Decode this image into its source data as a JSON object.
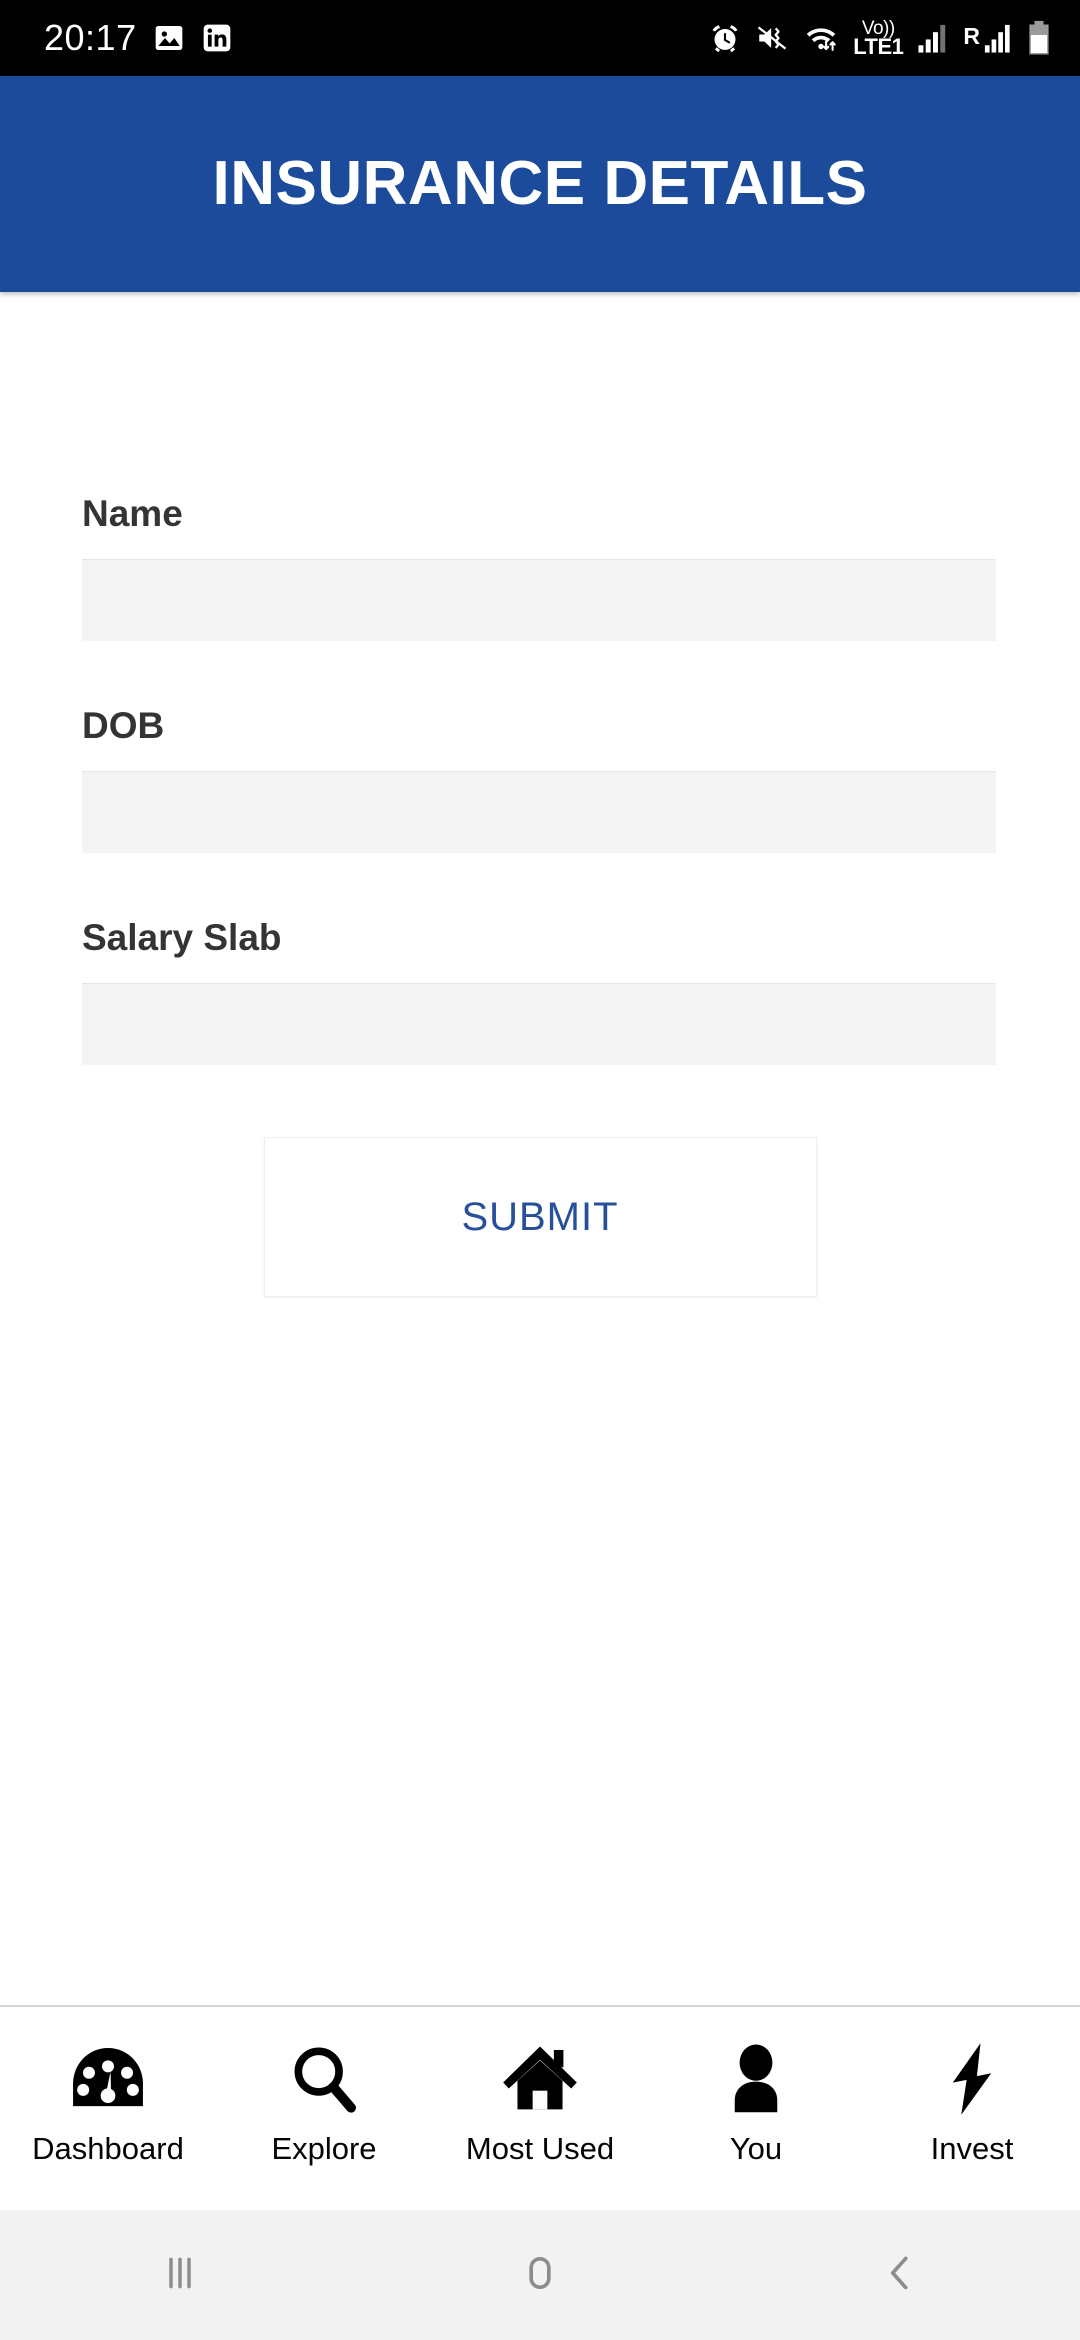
{
  "status_bar": {
    "time": "20:17",
    "left_icons": [
      {
        "name": "photo-icon",
        "label": "image"
      },
      {
        "name": "linkedin-icon",
        "label": "in"
      }
    ],
    "right_icons": [
      {
        "name": "alarm-icon",
        "label": "alarm"
      },
      {
        "name": "vibrate-mute-icon",
        "label": "vibrate"
      },
      {
        "name": "wifi-data-icon",
        "label": "wifi"
      }
    ],
    "volte_top": "Vo))",
    "volte_bottom": "LTE1",
    "roaming_letter": "R",
    "background": "#000000"
  },
  "header": {
    "title": "INSURANCE DETAILS",
    "background": "#1c4b9b",
    "text_color": "#ffffff"
  },
  "form": {
    "fields": [
      {
        "label": "Name",
        "value": "",
        "placeholder": ""
      },
      {
        "label": "DOB",
        "value": "",
        "placeholder": ""
      },
      {
        "label": "Salary Slab",
        "value": "",
        "placeholder": ""
      }
    ],
    "submit_label": "SUBMIT",
    "submit_text_color": "#27509a",
    "input_background": "#f4f4f4"
  },
  "bottom_nav": {
    "items": [
      {
        "label": "Dashboard",
        "icon": "speedometer-icon"
      },
      {
        "label": "Explore",
        "icon": "search-icon"
      },
      {
        "label": "Most Used",
        "icon": "home-icon"
      },
      {
        "label": "You",
        "icon": "person-icon"
      },
      {
        "label": "Invest",
        "icon": "lightning-bolt-icon"
      }
    ]
  },
  "system_nav": {
    "recents_label": "recents",
    "home_label": "home",
    "back_label": "back",
    "background": "#f2f2f2"
  }
}
